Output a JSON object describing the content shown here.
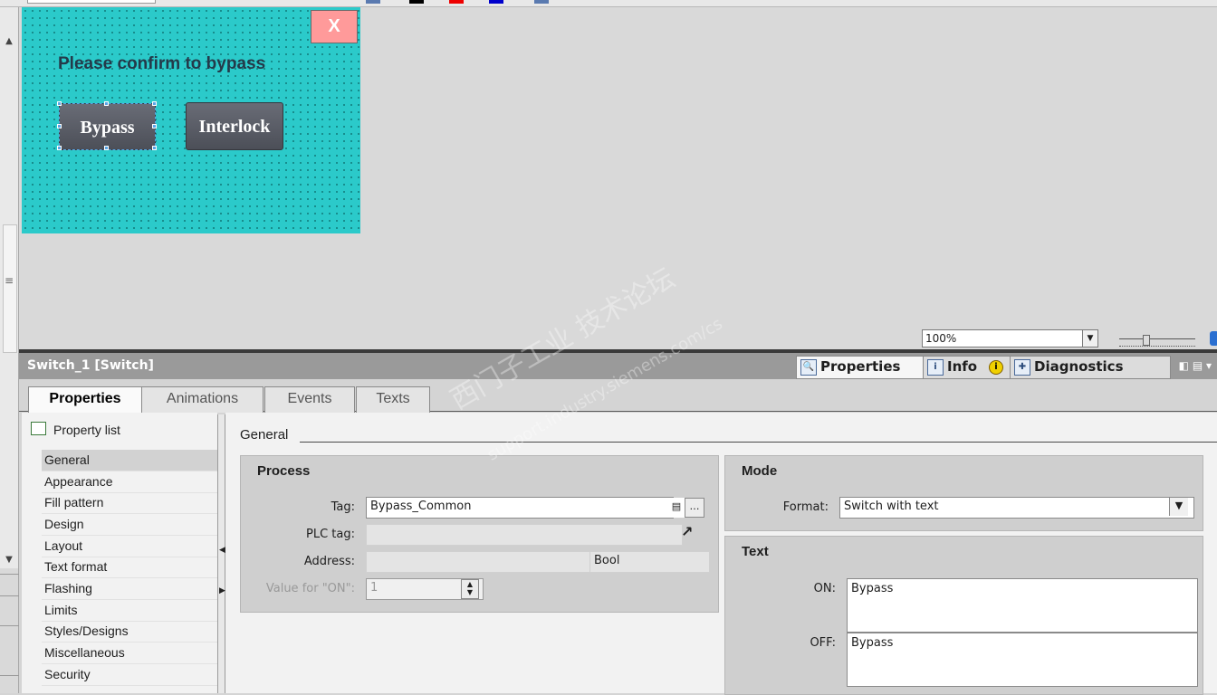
{
  "screen": {
    "close_label": "X",
    "confirm_text": "Please confirm to bypass",
    "bypass_label": "Bypass",
    "interlock_label": "Interlock",
    "bg_color": "#2bcaca",
    "close_color": "#ff9a9a"
  },
  "zoom": {
    "value": "100%"
  },
  "inspector": {
    "title": "Switch_1 [Switch]",
    "panel_tabs": {
      "properties": "Properties",
      "info": "Info",
      "diagnostics": "Diagnostics"
    },
    "tabs": [
      "Properties",
      "Animations",
      "Events",
      "Texts"
    ],
    "property_list_label": "Property list",
    "nav_items": [
      "General",
      "Appearance",
      "Fill pattern",
      "Design",
      "Layout",
      "Text format",
      "Flashing",
      "Limits",
      "Styles/Designs",
      "Miscellaneous",
      "Security"
    ],
    "section_title": "General"
  },
  "process": {
    "title": "Process",
    "tag_label": "Tag:",
    "tag_value": "Bypass_Common",
    "plc_tag_label": "PLC tag:",
    "address_label": "Address:",
    "address_type": "Bool",
    "value_on_label": "Value for \"ON\":",
    "value_on": "1"
  },
  "mode": {
    "title": "Mode",
    "format_label": "Format:",
    "format_value": "Switch with text"
  },
  "text": {
    "title": "Text",
    "on_label": "ON:",
    "on_value": "Bypass",
    "off_label": "OFF:",
    "off_value": "Bypass"
  },
  "watermark": {
    "line1": "西门子工业 技术论坛",
    "line2": "support.industry.siemens.com/cs"
  }
}
